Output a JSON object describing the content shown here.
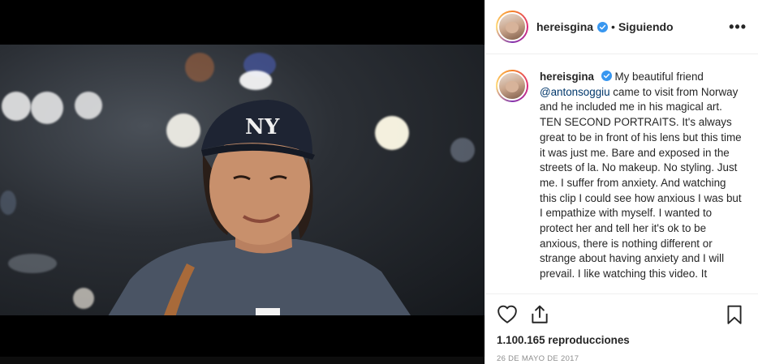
{
  "post": {
    "username": "hereisgina",
    "separator": "•",
    "follow_status": "Siguiendo",
    "more": "•••"
  },
  "caption": {
    "username": "hereisgina",
    "mention": "@antonsoggiu",
    "text_part1": "My beautiful friend",
    "text_part2": "came to visit from Norway and he included me in his magical art. TEN SECOND PORTRAITS. It's always great to be in front of his lens but this time it was just me. Bare and exposed in the streets of la. No makeup. No styling. Just me. I suffer from anxiety. And watching this clip I could see how anxious I was but I empathize with myself. I wanted to protect her and tell her it's ok to be anxious, there is nothing different or strange about having anxiety and I will prevail. I like watching this video. It"
  },
  "stats": {
    "views": "1.100.165 reproducciones",
    "date": "26 DE MAYO DE 2017"
  },
  "colors": {
    "verified": "#3897f0",
    "text": "#262626",
    "muted": "#8e8e8e"
  },
  "icons": {
    "like": "heart-icon",
    "share": "share-icon",
    "save": "bookmark-icon",
    "verified": "verified-badge-icon"
  }
}
